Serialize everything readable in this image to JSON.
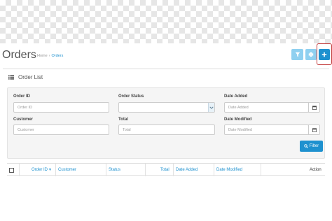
{
  "page": {
    "title": "Orders"
  },
  "breadcrumb": {
    "home": "Home",
    "separator": "›",
    "current": "Orders"
  },
  "toolbar": {
    "filter_toggle_icon": "filter-icon",
    "print_icon": "print-icon",
    "add_icon": "plus-icon"
  },
  "panel": {
    "title": "Order List",
    "icon": "list-icon"
  },
  "filters": {
    "order_id": {
      "label": "Order ID",
      "placeholder": "Order ID"
    },
    "order_status": {
      "label": "Order Status",
      "value": ""
    },
    "date_added": {
      "label": "Date Added",
      "placeholder": "Date Added"
    },
    "customer": {
      "label": "Customer",
      "placeholder": "Customer"
    },
    "total": {
      "label": "Total",
      "placeholder": "Total"
    },
    "date_modified": {
      "label": "Date Modified",
      "placeholder": "Date Modified"
    },
    "filter_button": "Filter"
  },
  "table": {
    "columns": [
      "Order ID",
      "Customer",
      "Status",
      "Total",
      "Date Added",
      "Date Modified",
      "Action"
    ]
  },
  "colors": {
    "accent": "#1e91cf",
    "accent_light": "#8fd0f0",
    "highlight": "#c23b3b"
  }
}
